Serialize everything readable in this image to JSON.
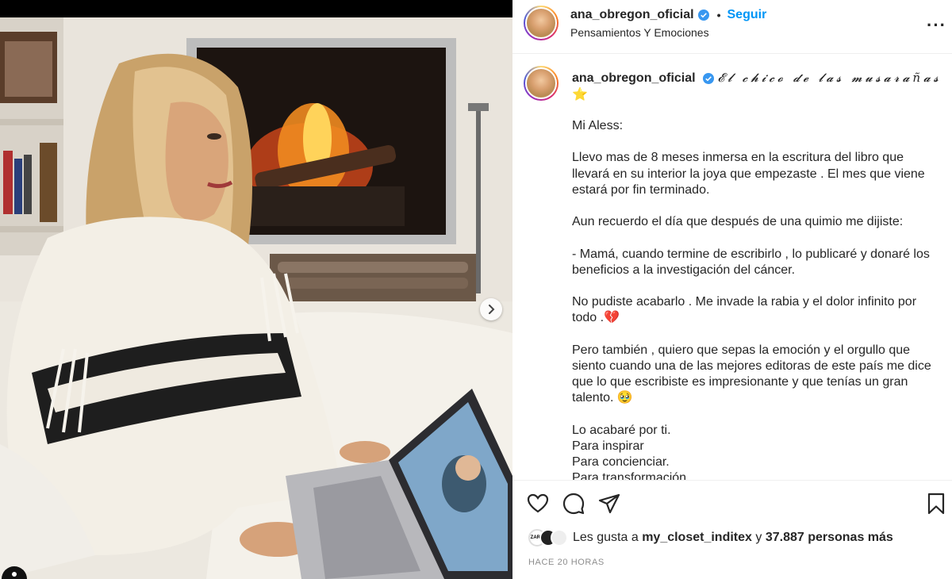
{
  "header": {
    "username": "ana_obregon_oficial",
    "separator": "•",
    "follow_label": "Seguir",
    "subtitle": "Pensamientos Y Emociones",
    "more_icon": "more-horizontal-icon",
    "more_glyph": "···"
  },
  "caption": {
    "username": "ana_obregon_oficial",
    "title": "𝓔𝓵 𝓬𝓱𝓲𝓬𝓸 𝓭𝓮 𝓵𝓪𝓼 𝓶𝓾𝓼𝓪𝓻𝓪ñ𝓪𝓼",
    "star": "⭐️",
    "paragraphs": [
      "Mi Aless:",
      "Llevo mas de 8 meses inmersa en la escritura del libro que llevará en su interior la joya que empezaste . El mes que viene estará por fin terminado.",
      "Aun recuerdo el día que después de una quimio me dijiste:",
      "- Mamá, cuando termine de escribirlo , lo publicaré y donaré los beneficios a la investigación del cáncer.",
      "No pudiste acabarlo . Me invade la rabia y el dolor infinito por todo .💔",
      "Pero también , quiero que sepas la emoción y el orgullo que siento cuando una de las mejores editoras de este país me dice que lo que escribiste es impresionante y que tenías un gran talento. 🥹"
    ],
    "closing_lines": [
      "Lo acabaré por ti.",
      "Para inspirar",
      "Para concienciar.",
      "Para transformación"
    ]
  },
  "actions": {
    "like_icon": "heart-icon",
    "comment_icon": "comment-icon",
    "share_icon": "send-icon",
    "save_icon": "bookmark-icon"
  },
  "likes": {
    "prefix": "Les gusta a",
    "user": "my_closet_inditex",
    "connector": "y",
    "count_text": "37.887 personas más",
    "avatar_labels": [
      "ZARA",
      "",
      ""
    ]
  },
  "timestamp": "Hace 20 horas",
  "media": {
    "next_icon": "chevron-right-icon",
    "tag_icon": "user-tag-icon"
  },
  "colors": {
    "accent": "#0095f6",
    "verified": "#3897f0",
    "muted": "#8e8e8e"
  }
}
